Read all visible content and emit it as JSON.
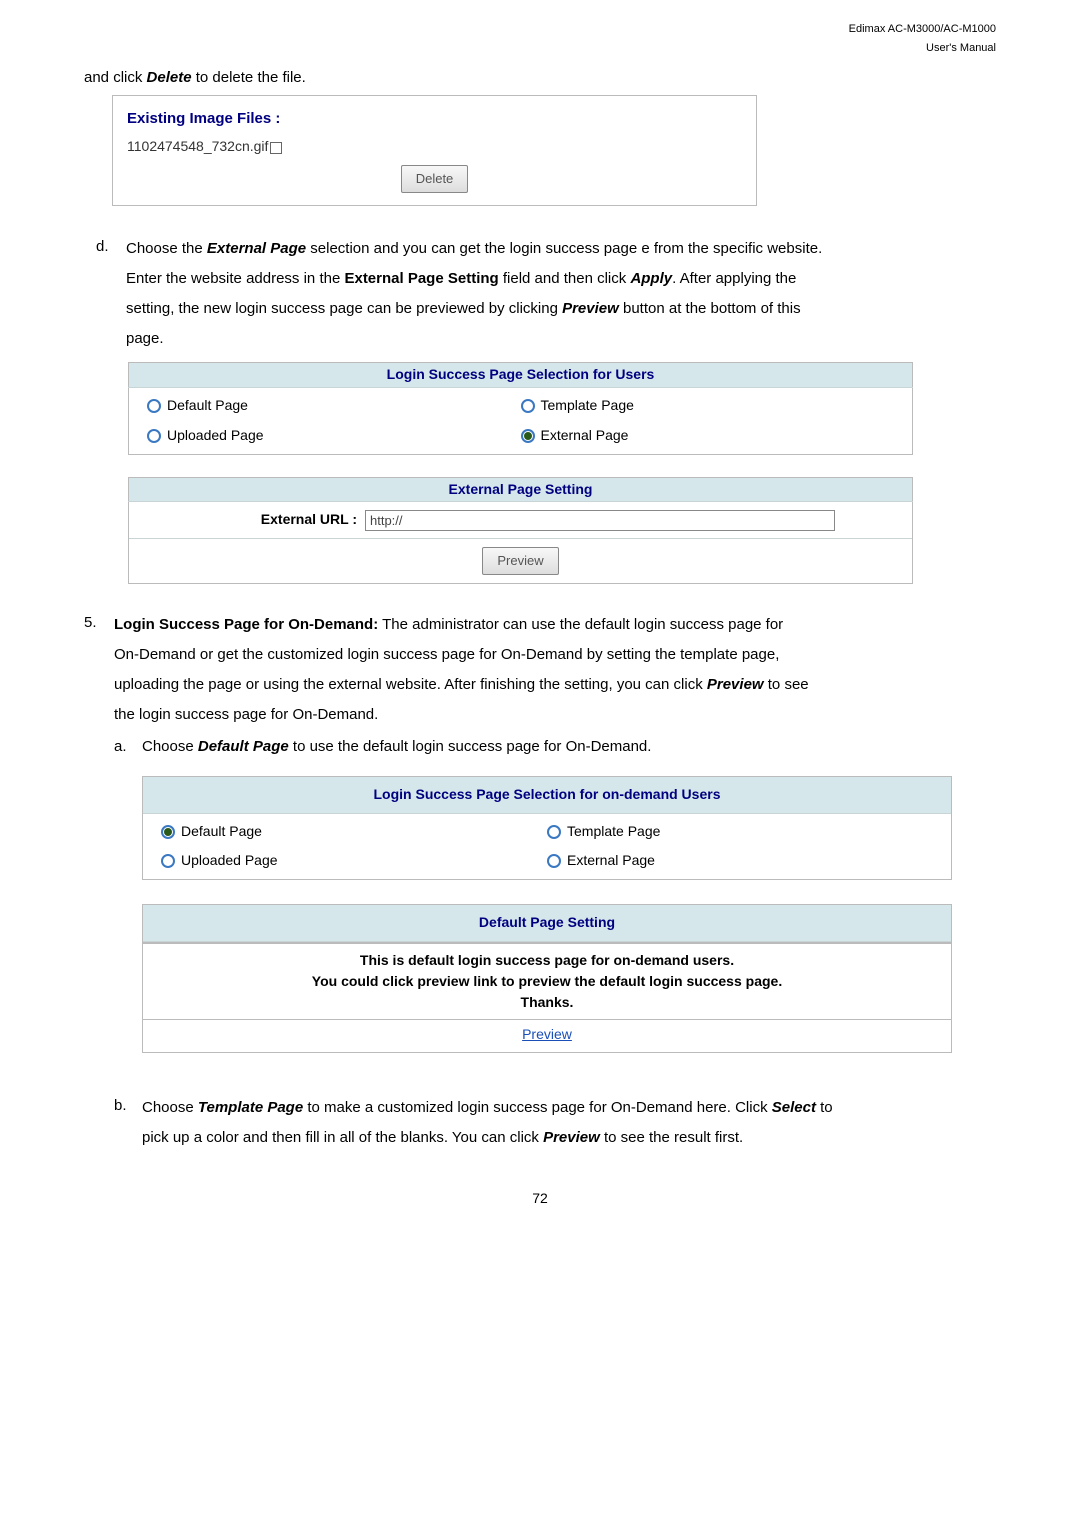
{
  "header": {
    "product": "Edimax  AC-M3000/AC-M1000",
    "manual_type": "User's  Manual"
  },
  "intro_line_pre": "and click ",
  "intro_bold": "Delete",
  "intro_line_post": " to delete the file.",
  "filebox": {
    "title": "Existing Image Files :",
    "filename": "1102474548_732cn.gif",
    "delete_btn": "Delete"
  },
  "step_d": {
    "marker": "d.",
    "l1_pre": "Choose the ",
    "l1_bold": "External Page",
    "l1_post": " selection and you can get the login success page e from the specific website.",
    "l2_pre": "Enter the website address in the ",
    "l2_bold": "External Page Setting",
    "l2_mid": " field and then click ",
    "l2_bold2": "Apply",
    "l2_post": ". After applying the",
    "l3_pre": "setting, the new login success page can be previewed by clicking ",
    "l3_bold": "Preview",
    "l3_post": " button at the bottom of this",
    "l4": "page."
  },
  "panel1": {
    "head": "Login Success Page Selection for Users",
    "default_page": "Default Page",
    "template_page": "Template Page",
    "uploaded_page": "Uploaded Page",
    "external_page": "External Page",
    "ext_head": "External Page Setting",
    "url_label": "External URL :",
    "url_value": "http://",
    "preview_btn": "Preview"
  },
  "step_5": {
    "marker": "5.",
    "bold": "Login Success Page for On-Demand:",
    "l1_post": " The administrator can use the default login success page for",
    "l2": "On-Demand or get the customized login success page for On-Demand by setting the template page,",
    "l3_pre": "uploading the page or using the external website. After finishing the setting, you can click ",
    "l3_bold": "Preview",
    "l3_post": " to see",
    "l4": "the login success page for On-Demand."
  },
  "sub_a": {
    "marker": "a.",
    "pre": "Choose ",
    "bold": "Default Page",
    "post": " to use the default login success page for On-Demand."
  },
  "panel2": {
    "head": "Login Success Page Selection for on-demand Users",
    "default_page": "Default Page",
    "template_page": "Template Page",
    "uploaded_page": "Uploaded Page",
    "external_page": "External Page",
    "def_head": "Default Page Setting",
    "info1": "This is default login success page for on-demand users.",
    "info2": "You could click preview link to preview the default login success page.",
    "info3": "Thanks.",
    "preview_link": "Preview"
  },
  "step_b": {
    "marker": "b.",
    "pre": "Choose ",
    "bold1": "Template Page",
    "mid1": " to make a customized login success page for On-Demand here. Click ",
    "bold2": "Select",
    "mid2": " to",
    "l2_pre": "pick up a color and then fill in all of the blanks. You can click ",
    "l2_bold": "Preview",
    "l2_post": " to see the result first."
  },
  "page_num": "72"
}
